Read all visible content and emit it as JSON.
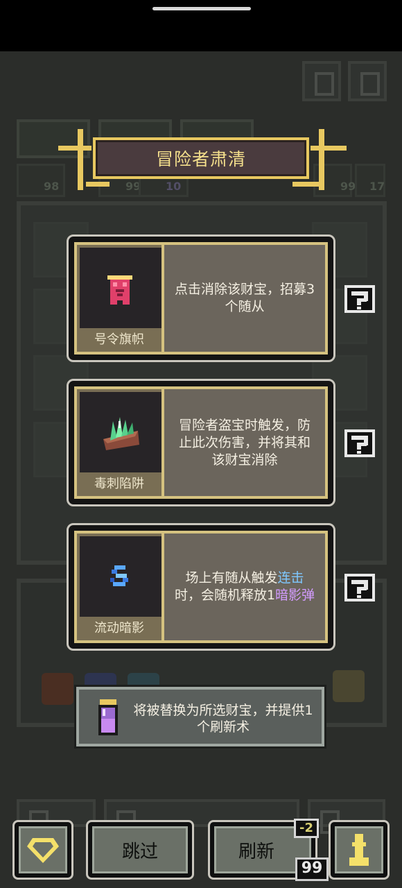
{
  "header": {
    "title": "冒险者肃清"
  },
  "cards": [
    {
      "name": "号令旗帜",
      "desc_parts": [
        {
          "text": "点击消除该财宝，招募3个随从",
          "style": ""
        }
      ],
      "icon": "banner-flag-icon"
    },
    {
      "name": "毒刺陷阱",
      "desc_parts": [
        {
          "text": "冒险者盗宝时触发，防止此次伤害，并将其和该财宝消除",
          "style": ""
        }
      ],
      "icon": "poison-spike-trap-icon"
    },
    {
      "name": "流动暗影",
      "desc_parts": [
        {
          "text": "场上有随从触发",
          "style": ""
        },
        {
          "text": "连击",
          "style": "hl-blue"
        },
        {
          "text": "时，会随机释放1",
          "style": ""
        },
        {
          "text": "暗影弹",
          "style": "hl-purple"
        }
      ],
      "icon": "flowing-shadow-icon"
    }
  ],
  "help_button": {
    "icon": "question-mark-icon"
  },
  "popup": {
    "text": "将被替换为所选财宝，并提供1个刷新术",
    "icon": "potion-bottle-icon"
  },
  "footer": {
    "gem_icon": "gem-icon",
    "skip_label": "跳过",
    "refresh_label": "刷新",
    "refresh_cost": "-2",
    "refresh_count": "99",
    "pawn_icon": "pawn-icon"
  },
  "background": {
    "stats": [
      "98",
      "99",
      "10",
      "99",
      "17"
    ],
    "stat_label": "2"
  },
  "colors": {
    "gold": "#e8c860",
    "highlight_blue": "#7fc8ff",
    "highlight_purple": "#d39cff",
    "card_text": "#f4efe2"
  }
}
